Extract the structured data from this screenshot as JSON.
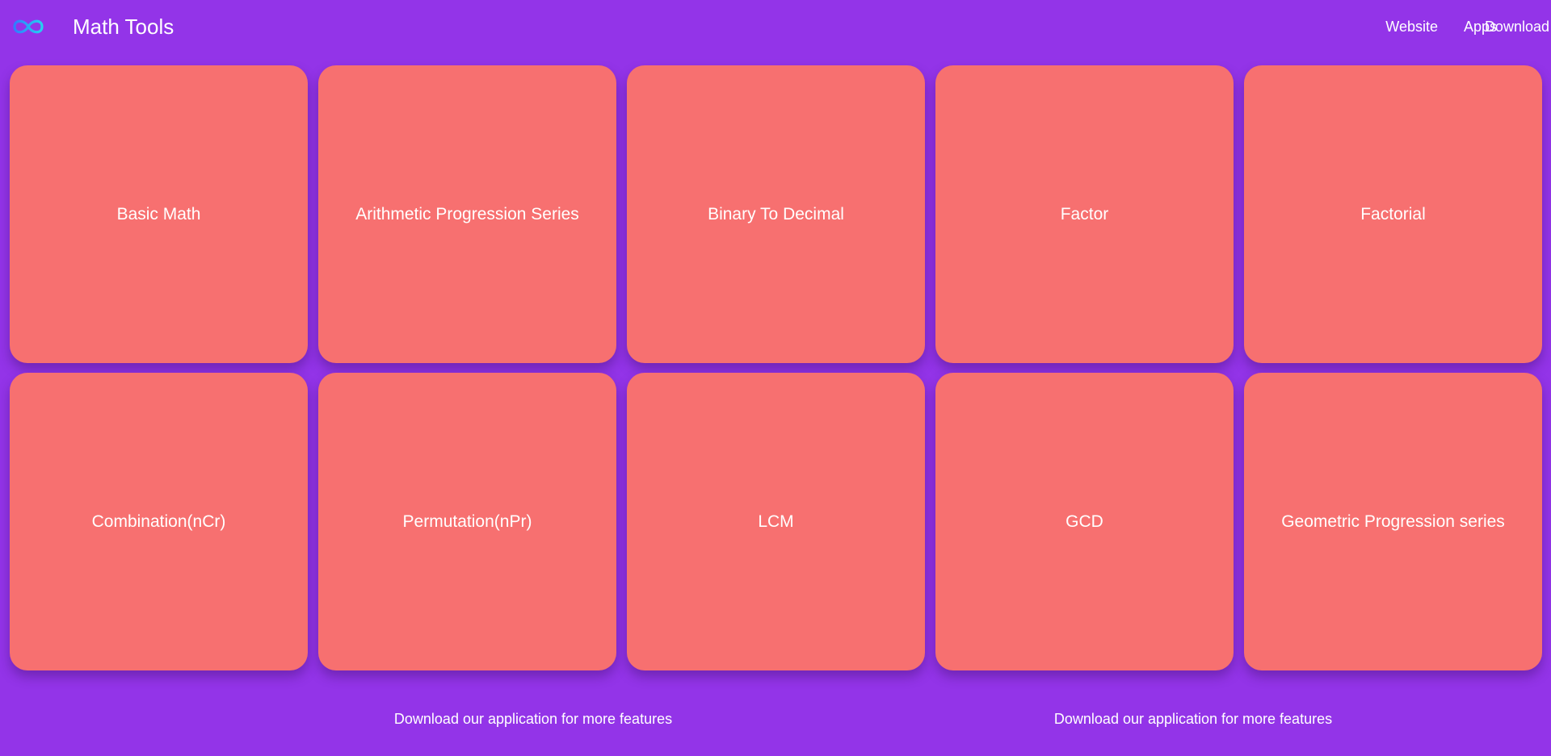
{
  "header": {
    "brand": "Math Tools",
    "logo_icon": "infinity-icon",
    "logo_colors": [
      "#2f7dff",
      "#26d0f0"
    ],
    "nav": [
      {
        "label": "Website"
      },
      {
        "label": "Apps"
      },
      {
        "label": "Download"
      }
    ]
  },
  "tools": [
    {
      "label": "Basic Math"
    },
    {
      "label": "Arithmetic Progression Series"
    },
    {
      "label": "Binary To Decimal"
    },
    {
      "label": "Factor"
    },
    {
      "label": "Factorial"
    },
    {
      "label": "Combination(nCr)"
    },
    {
      "label": "Permutation(nPr)"
    },
    {
      "label": "LCM"
    },
    {
      "label": "GCD"
    },
    {
      "label": "Geometric Progression series"
    }
  ],
  "footer": {
    "messages": [
      "Download our application for more features",
      "Download our application for more features"
    ]
  },
  "colors": {
    "background": "#9334e8",
    "card": "#f77070",
    "text": "#ffffff"
  }
}
